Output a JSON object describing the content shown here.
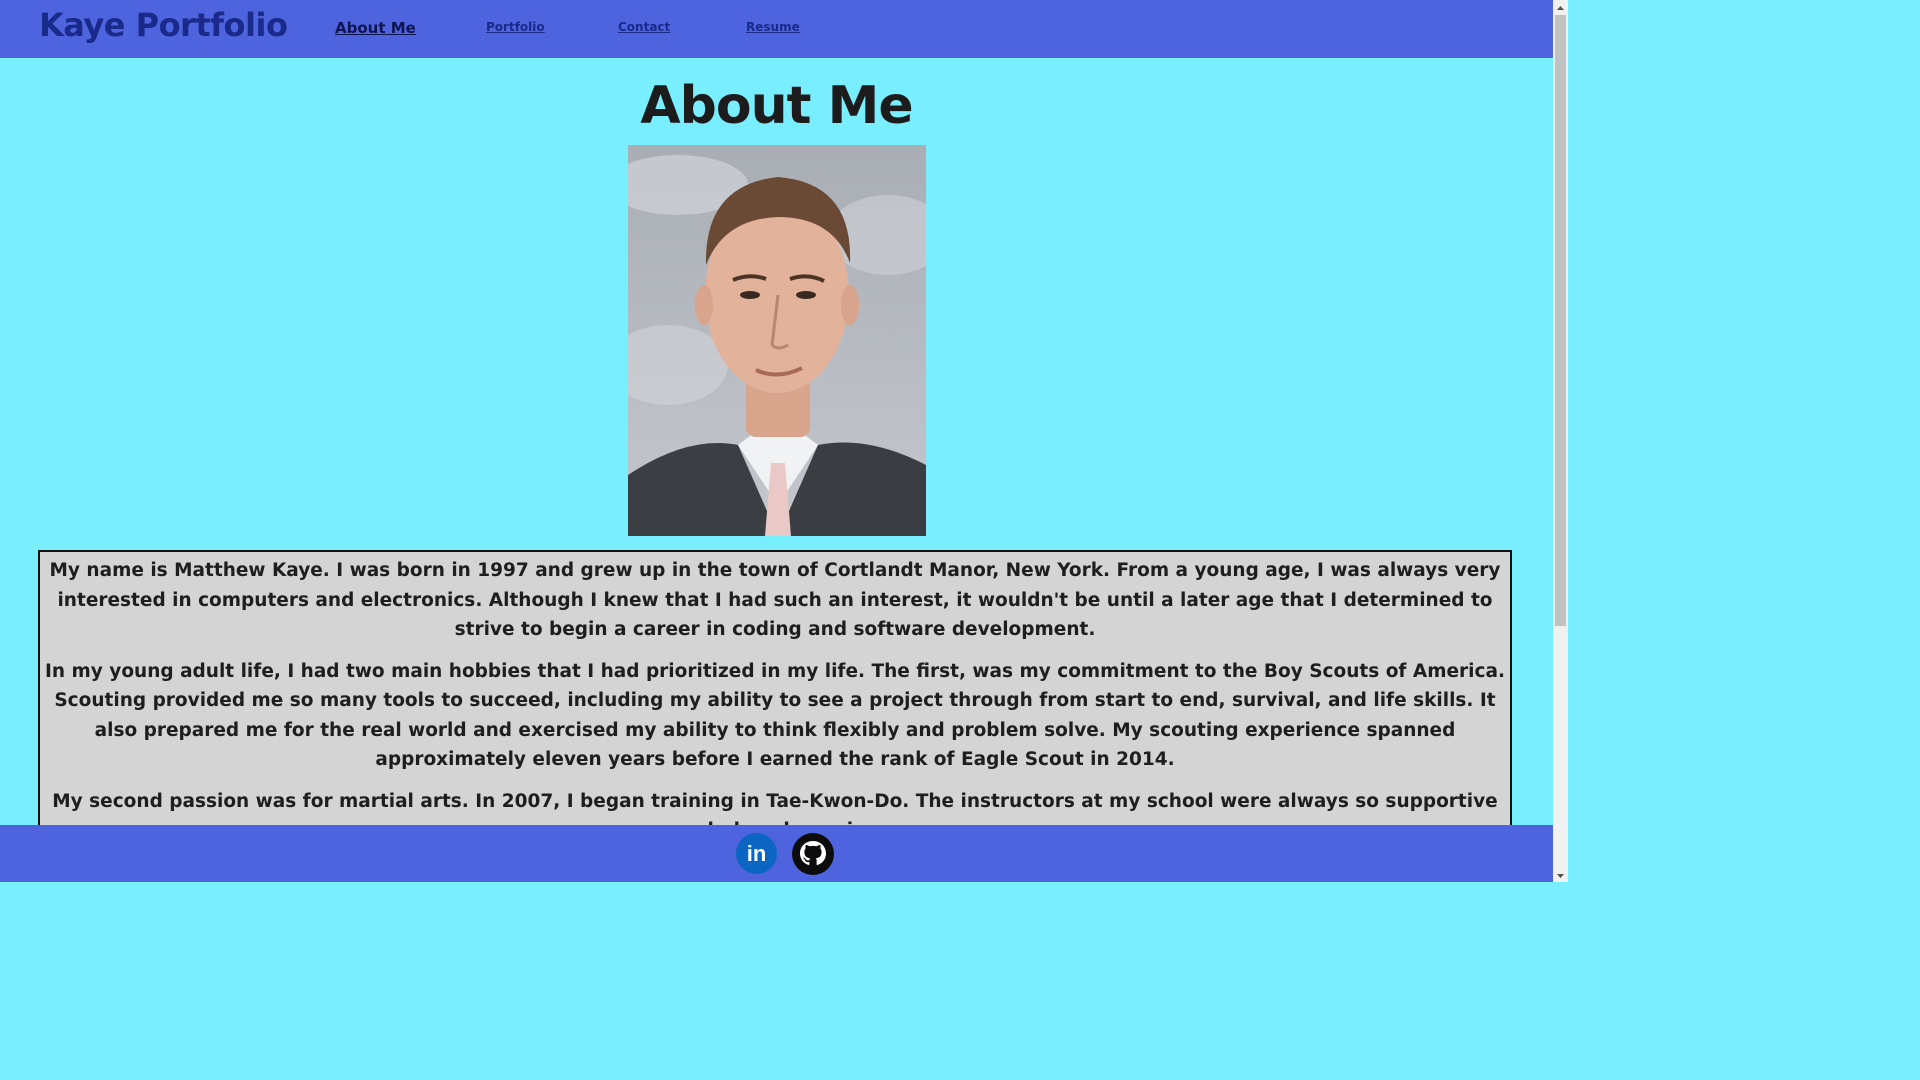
{
  "nav": {
    "brand": "Kaye Portfolio",
    "links": [
      {
        "label": "About Me"
      },
      {
        "label": "Portfolio"
      },
      {
        "label": "Contact"
      },
      {
        "label": "Resume"
      }
    ]
  },
  "main": {
    "title": "About Me",
    "portrait": {
      "icon": "profile-photo"
    },
    "bio": [
      "My name is Matthew Kaye. I was born in 1997 and grew up in the town of Cortlandt Manor, New York. From a young age, I was always very interested in computers and electronics. Although I knew that I had such an interest, it wouldn't be until a later age that I determined to strive to begin a career in coding and software development.",
      "In my young adult life, I had two main hobbies that I had prioritized in my life. The first, was my commitment to the Boy Scouts of America. Scouting provided me so many tools to succeed, including my ability to see a project through from start to end, survival, and life skills. It also prepared me for the real world and exercised my ability to think flexibly and problem solve. My scouting experience spanned approximately eleven years before I earned the rank of Eagle Scout in 2014.",
      "My second passion was for martial arts. In 2007, I began training in Tae-Kwon-Do. The instructors at my school were always so supportive and played a major"
    ]
  },
  "footer": {
    "links": [
      {
        "icon": "linkedin-icon",
        "label": "in"
      },
      {
        "icon": "github-icon"
      }
    ]
  },
  "colors": {
    "header_bg": "#4e64de",
    "page_bg": "#78eefe",
    "bio_bg": "#d4d4d4",
    "brand_text": "#1a2a8a",
    "linkedin": "#0a66c2"
  }
}
